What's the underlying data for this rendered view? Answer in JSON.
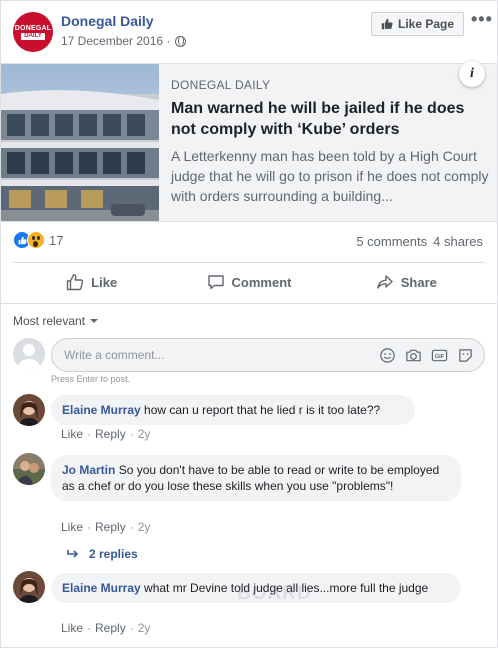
{
  "post": {
    "page_name": "Donegal Daily",
    "avatar_text_1": "DONEGAL",
    "avatar_text_2": "DAILY",
    "date": "17 December 2016 ·",
    "like_page_label": "Like Page",
    "more_label": "•••"
  },
  "link": {
    "source": "DONEGAL DAILY",
    "title": "Man warned he will be jailed if he does not comply with ‘Kube’ orders",
    "description": "A Letterkenny man has been told by a High Court judge that he will go to prison if he does not comply with orders surrounding a building...",
    "info_label": "i"
  },
  "stats": {
    "reaction_count": "17",
    "comments": "5 comments",
    "shares": "4 shares"
  },
  "actions": {
    "like": "Like",
    "comment": "Comment",
    "share": "Share"
  },
  "sort": {
    "label": "Most relevant"
  },
  "composer": {
    "placeholder": "Write a comment...",
    "hint": "Press Enter to post.",
    "icons": [
      "emoji-icon",
      "camera-icon",
      "gif-icon",
      "sticker-icon"
    ]
  },
  "comments": [
    {
      "author": "Elaine Murray",
      "text": "how can u report that he lied r is it too late??",
      "like": "Like",
      "reply": "Reply",
      "time": "2y"
    },
    {
      "author": "Jo Martin",
      "text": "So you don't have to be able to read or write to be employed as a chef or do you lose these skills when you use \"problems\"!",
      "like": "Like",
      "reply": "Reply",
      "time": "2y"
    },
    {
      "author": "Elaine Murray",
      "text": "what mr Devine told judge all lies...more full the judge",
      "like": "Like",
      "reply": "Reply",
      "time": "2y"
    }
  ],
  "replies": {
    "label": "2 replies"
  },
  "watermark": "BOARD",
  "colors": {
    "brand_red": "#c8102e",
    "link_blue": "#385898",
    "fb_blue": "#1877f2"
  }
}
